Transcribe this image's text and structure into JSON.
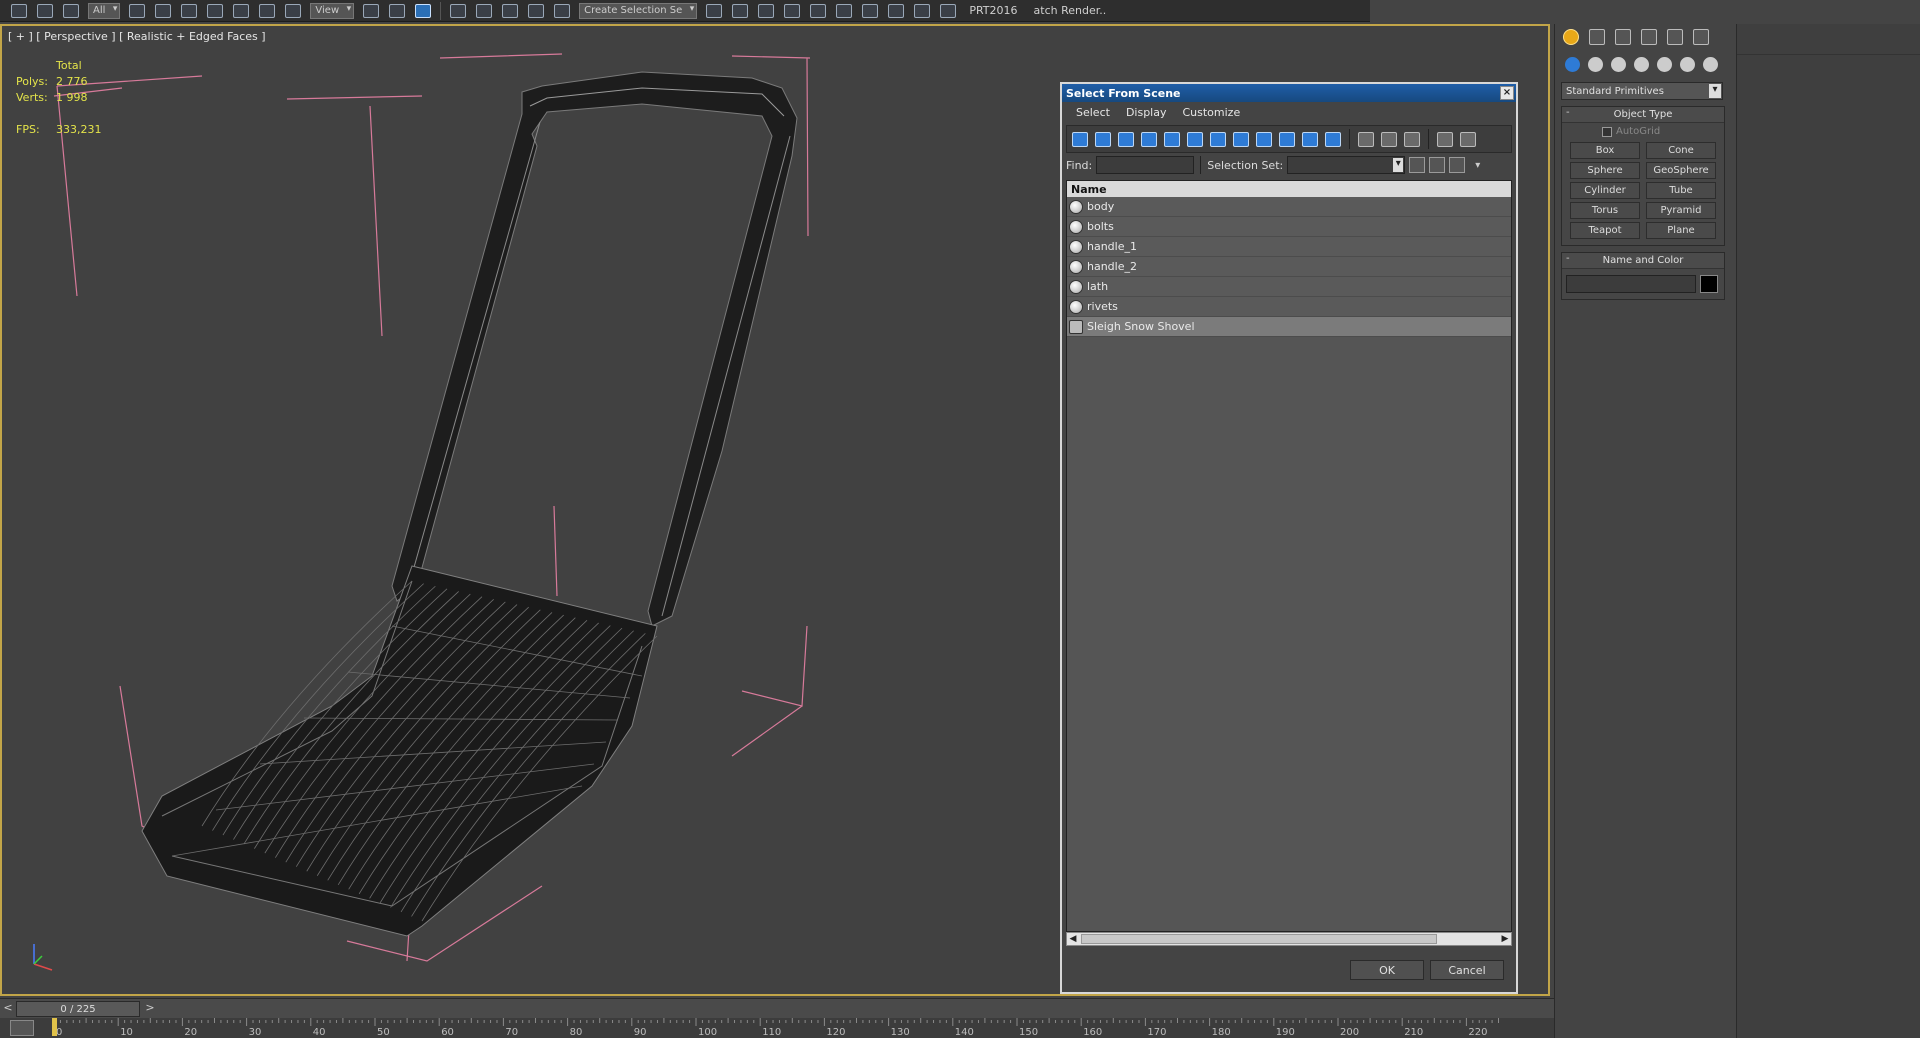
{
  "toolbar": {
    "filter_value": "All",
    "view_value": "View",
    "selection_set_value": "Create Selection Se",
    "prt_label": "PRT2016",
    "batch_render_label": "atch Render..",
    "accent_color": "#2b6fb6"
  },
  "viewport": {
    "label": "[ + ] [ Perspective ] [ Realistic + Edged Faces ]",
    "border_color": "#c2a548",
    "stats": {
      "total_label": "Total",
      "polys_label": "Polys:",
      "polys_value": "2 776",
      "verts_label": "Verts:",
      "verts_value": "1 998",
      "fps_label": "FPS:",
      "fps_value": "333,231",
      "color": "#e4e44a"
    }
  },
  "dialog": {
    "title": "Select From Scene",
    "close_glyph": "×",
    "menu": [
      "Select",
      "Display",
      "Customize"
    ],
    "find_label": "Find:",
    "find_value": "",
    "selection_set_label": "Selection Set:",
    "selection_set_value": "",
    "column_header": "Name",
    "items": [
      {
        "name": "body",
        "icon": "geometry-sphere-icon",
        "selected": false
      },
      {
        "name": "bolts",
        "icon": "geometry-sphere-icon",
        "selected": false
      },
      {
        "name": "handle_1",
        "icon": "geometry-sphere-icon",
        "selected": false
      },
      {
        "name": "handle_2",
        "icon": "geometry-sphere-icon",
        "selected": false
      },
      {
        "name": "lath",
        "icon": "geometry-sphere-icon",
        "selected": false
      },
      {
        "name": "rivets",
        "icon": "geometry-sphere-icon",
        "selected": false
      },
      {
        "name": "Sleigh Snow Shovel",
        "icon": "group-icon",
        "selected": true
      }
    ],
    "ok_label": "OK",
    "cancel_label": "Cancel",
    "title_color": "#1f5ea8"
  },
  "command_panel": {
    "category_value": "Standard Primitives",
    "object_type_title": "Object Type",
    "autogrid_label": "AutoGrid",
    "primitives": [
      "Box",
      "Cone",
      "Sphere",
      "GeoSphere",
      "Cylinder",
      "Tube",
      "Torus",
      "Pyramid",
      "Teapot",
      "Plane"
    ],
    "name_color_title": "Name and Color",
    "name_value": "",
    "color_value": "#000000"
  },
  "timeline": {
    "frame_display": "0 / 225",
    "prev_glyph": "<",
    "next_glyph": ">",
    "ticks": [
      "0",
      "10",
      "20",
      "30",
      "40",
      "50",
      "60",
      "70",
      "80",
      "90",
      "100",
      "110",
      "120",
      "130",
      "140",
      "150",
      "160",
      "170",
      "180",
      "190",
      "200",
      "210",
      "220"
    ]
  }
}
